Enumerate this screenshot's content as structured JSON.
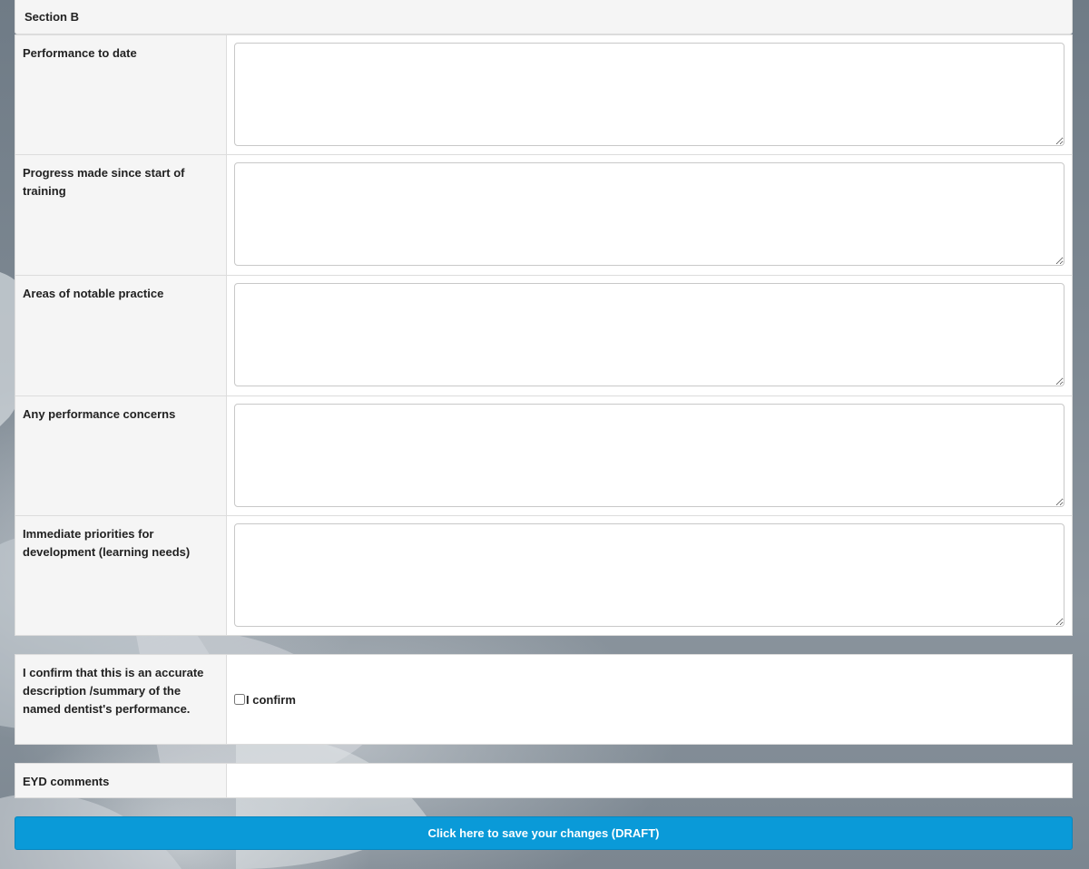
{
  "section": {
    "title": "Section B"
  },
  "fields": [
    {
      "label": "Performance to date",
      "value": ""
    },
    {
      "label": "Progress made since start of training",
      "value": ""
    },
    {
      "label": "Areas of notable practice",
      "value": ""
    },
    {
      "label": "Any performance concerns",
      "value": ""
    },
    {
      "label": "Immediate priorities for development (learning needs)",
      "value": ""
    }
  ],
  "confirmation": {
    "label": "I confirm that this is an accurate description /summary of the named dentist's performance.",
    "checkbox_label": "I confirm",
    "checked": false
  },
  "eyd": {
    "label": "EYD comments",
    "value": ""
  },
  "actions": {
    "save_label": "Click here to save your changes (DRAFT)"
  },
  "colors": {
    "button": "#0a9ad8",
    "panel": "#f5f5f5",
    "background": "#7d8892"
  }
}
